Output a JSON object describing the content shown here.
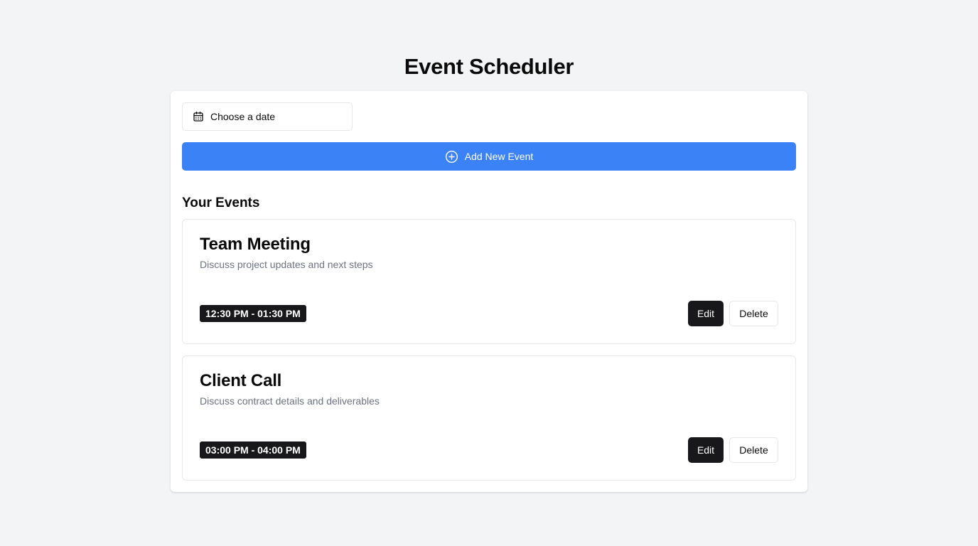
{
  "app": {
    "title": "Event Scheduler"
  },
  "toolbar": {
    "date_placeholder": "Choose a date",
    "date_icon": "calendar-icon",
    "add_label": "Add New Event",
    "add_icon": "plus-circle-icon",
    "accent_color": "#3b82f6"
  },
  "events_section": {
    "title": "Your Events",
    "items": [
      {
        "title": "Team Meeting",
        "description": "Discuss project updates and next steps",
        "time": "12:30 PM - 01:30 PM",
        "edit_label": "Edit",
        "delete_label": "Delete"
      },
      {
        "title": "Client Call",
        "description": "Discuss contract details and deliverables",
        "time": "03:00 PM - 04:00 PM",
        "edit_label": "Edit",
        "delete_label": "Delete"
      }
    ]
  }
}
